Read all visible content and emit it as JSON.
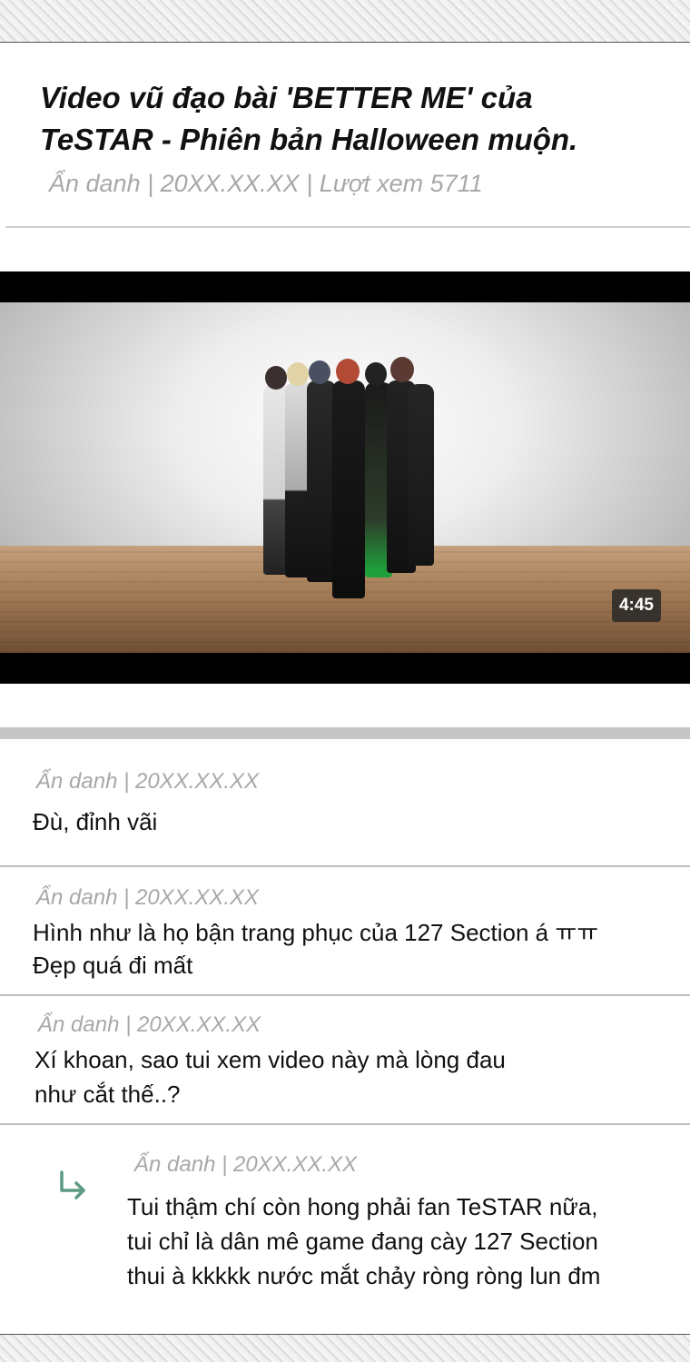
{
  "post": {
    "title_line1": "Video vũ đạo bài 'BETTER ME' của",
    "title_line2": "TeSTAR - Phiên bản Halloween muộn.",
    "meta": "Ẩn danh | 20XX.XX.XX | Lượt xem 5711"
  },
  "video": {
    "duration": "4:45"
  },
  "comments": [
    {
      "meta": "Ẩn danh | 20XX.XX.XX",
      "lines": [
        "Đù, đỉnh vãi"
      ]
    },
    {
      "meta": "Ẩn danh | 20XX.XX.XX",
      "lines": [
        "Hình như là họ bận trang phục của 127 Section á ㅠㅠ",
        "Đẹp quá đi mất"
      ]
    },
    {
      "meta": "Ẩn danh | 20XX.XX.XX",
      "lines": [
        "Xí khoan, sao tui xem video này mà lòng đau",
        "như cắt thế..?"
      ]
    }
  ],
  "reply": {
    "icon": "reply-arrow-icon",
    "meta": "Ẩn danh | 20XX.XX.XX",
    "lines": [
      "Tui thậm chí còn hong phải fan TeSTAR nữa,",
      "tui chỉ là dân mê game đang cày 127 Section",
      "thui à kkkkk nước mắt chảy ròng ròng lun đm"
    ]
  },
  "colors": {
    "meta_gray": "#a8a8a8",
    "reply_arrow": "#5c9a82",
    "divider": "#c6c6c6"
  }
}
